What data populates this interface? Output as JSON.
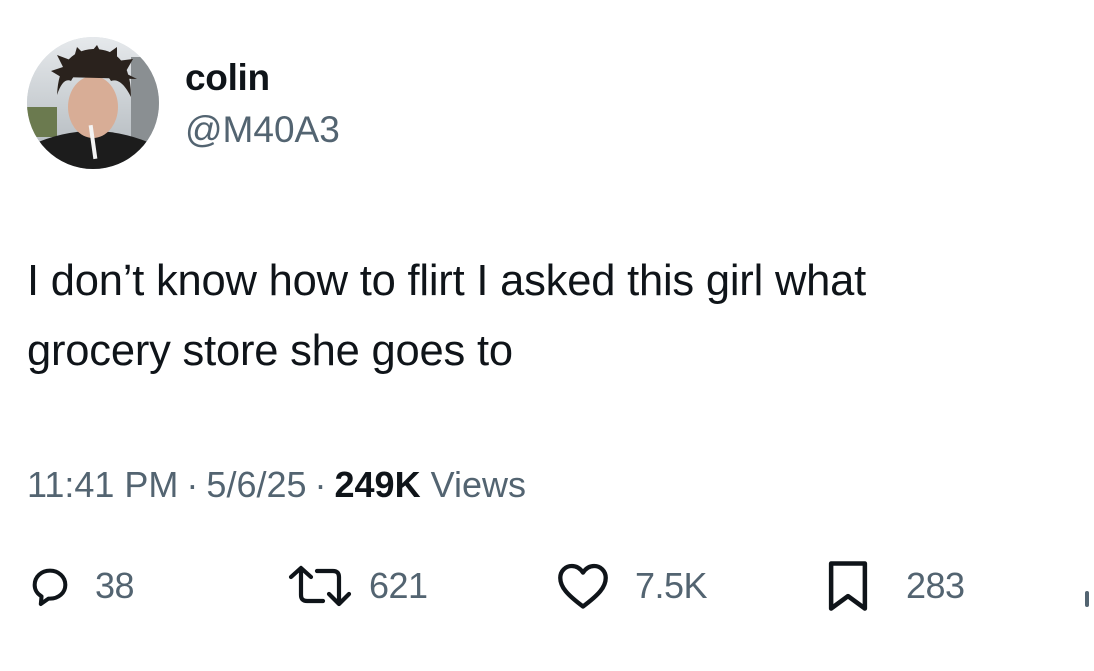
{
  "author": {
    "display_name": "colin",
    "handle": "@M40A3"
  },
  "tweet": {
    "text": "I don’t know how to flirt I asked this girl what\ngrocery store she goes to",
    "time": "11:41 PM",
    "date": "5/6/25",
    "views_count": "249K",
    "views_label": "Views",
    "separator": "·"
  },
  "stats": {
    "replies": "38",
    "reposts": "621",
    "likes": "7.5K",
    "bookmarks": "283"
  },
  "icons": {
    "reply": "reply-icon",
    "repost": "repost-icon",
    "like": "heart-icon",
    "bookmark": "bookmark-icon",
    "share": "share-icon"
  },
  "colors": {
    "text_primary": "#0f1419",
    "text_secondary": "#536471",
    "background": "#ffffff"
  }
}
